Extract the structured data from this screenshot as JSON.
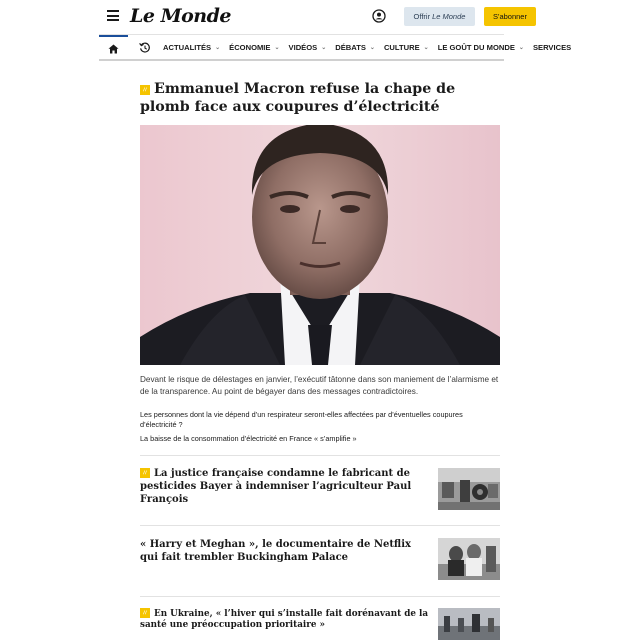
{
  "header": {
    "logo": "Le Monde",
    "offer_prefix": "Offrir",
    "offer_brand": "Le Monde",
    "subscribe": "S'abonner"
  },
  "nav": {
    "items": [
      {
        "label": "ACTUALITÉS",
        "chevron": true
      },
      {
        "label": "ÉCONOMIE",
        "chevron": true
      },
      {
        "label": "VIDÉOS",
        "chevron": true
      },
      {
        "label": "DÉBATS",
        "chevron": true
      },
      {
        "label": "CULTURE",
        "chevron": true
      },
      {
        "label": "LE GOÛT DU MONDE",
        "chevron": true
      },
      {
        "label": "SERVICES",
        "chevron": false
      }
    ]
  },
  "main": {
    "badge": "//",
    "headline": "Emmanuel Macron refuse la chape de plomb face aux coupures d’électricité",
    "lede": "Devant le risque de délestages en janvier, l’exécutif tâtonne dans son maniement de l’alarmisme et de la transparence. Au point de bégayer dans des messages contradictoires.",
    "related_1": "Les personnes dont la vie dépend d’un respirateur seront-elles affectées par d’éventuelles coupures d’électricité ?",
    "related_2": "La baisse de la consommation d’électricité en France « s’amplifie »"
  },
  "stories": [
    {
      "badge": "//",
      "title": "La justice française condamne le fabricant de pesticides Bayer à indemniser l’agriculteur Paul François",
      "meta": ""
    },
    {
      "badge": "",
      "title": "« Harry et Meghan », le documentaire de Netflix qui fait trembler Buckingham Palace",
      "meta": ""
    },
    {
      "badge": "//",
      "title": "En Ukraine, « l’hiver qui s’installe fait dorénavant de la santé une préoccupation prioritaire »",
      "meta": ""
    }
  ],
  "colors": {
    "accent_yellow": "#f5c400",
    "nav_active": "#1a4e9a",
    "offer_bg": "#dde6ee"
  }
}
